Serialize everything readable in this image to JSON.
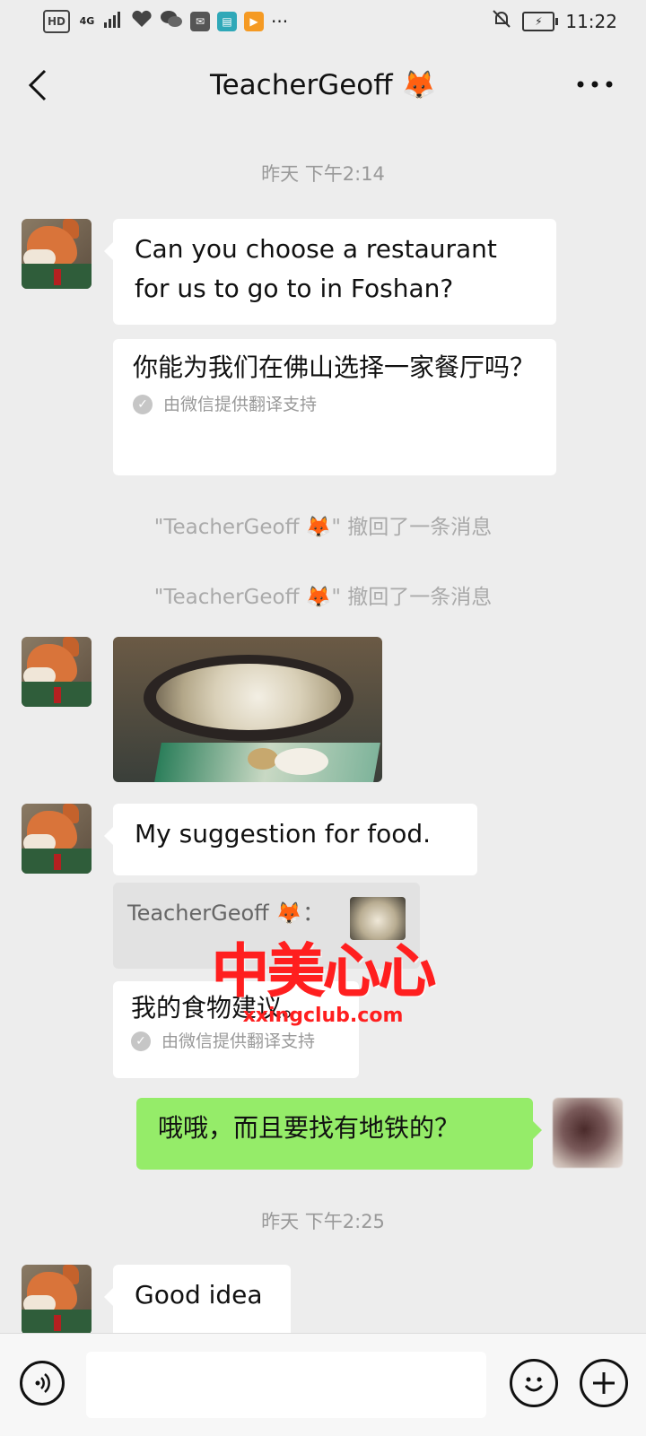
{
  "status_bar": {
    "network_hd": "HD",
    "network_4g": "4G",
    "time": "11:22"
  },
  "header": {
    "title": "TeacherGeoff 🦊",
    "back_icon": "chevron-left-icon",
    "more_icon": "more-dots-icon"
  },
  "chat": {
    "timestamps": [
      "昨天 下午2:14",
      "昨天 下午2:25"
    ],
    "messages": [
      {
        "sender": "TeacherGeoff 🦊",
        "type": "text",
        "text": "Can you choose a restaurant for us to go to in Foshan?",
        "translation": "你能为我们在佛山选择一家餐厅吗？"
      },
      {
        "sender": "TeacherGeoff 🦊",
        "type": "image",
        "icon": "food-photo"
      },
      {
        "sender": "TeacherGeoff 🦊",
        "type": "text",
        "text": "My suggestion for food.",
        "quote_author": "TeacherGeoff 🦊：",
        "translation": "我的食物建议。"
      },
      {
        "sender": "me",
        "type": "text",
        "text": "哦哦，而且要找有地铁的？"
      },
      {
        "sender": "TeacherGeoff 🦊",
        "type": "text",
        "text": "Good idea"
      }
    ],
    "translation_note": "由微信提供翻译支持",
    "recall_notices": [
      "\"TeacherGeoff 🦊\" 撤回了一条消息",
      "\"TeacherGeoff 🦊\" 撤回了一条消息"
    ]
  },
  "watermark": {
    "main": "中美心心",
    "sub": "xxingclub.com"
  },
  "input_bar": {
    "value": "",
    "voice_icon": "voice-icon",
    "emoji_icon": "emoji-icon",
    "plus_icon": "plus-icon"
  },
  "colors": {
    "background": "#ededed",
    "sent_bubble": "#95ec69",
    "received_bubble": "#ffffff",
    "watermark": "#ff1f1f"
  }
}
